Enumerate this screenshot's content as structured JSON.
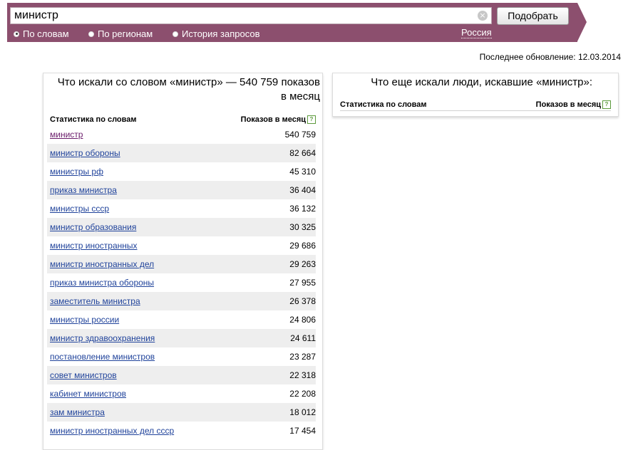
{
  "search": {
    "value": "министр",
    "submit_label": "Подобрать"
  },
  "modes": [
    {
      "label": "По словам",
      "checked": true
    },
    {
      "label": "По регионам",
      "checked": false
    },
    {
      "label": "История запросов",
      "checked": false
    }
  ],
  "region": "Россия",
  "last_update": "Последнее обновление:  12.03.2014",
  "left_panel": {
    "title": "Что искали со словом «министр» — 540 759 показов в месяц",
    "col_stats": "Статистика по словам",
    "col_shows": "Показов в месяц",
    "rows": [
      {
        "query": "министр",
        "count": "540 759"
      },
      {
        "query": "министр обороны",
        "count": "82 664"
      },
      {
        "query": "министры рф",
        "count": "45 310"
      },
      {
        "query": "приказ министра",
        "count": "36 404"
      },
      {
        "query": "министры ссср",
        "count": "36 132"
      },
      {
        "query": "министр образования",
        "count": "30 325"
      },
      {
        "query": "министр иностранных",
        "count": "29 686"
      },
      {
        "query": "министр иностранных дел",
        "count": "29 263"
      },
      {
        "query": "приказ министра обороны",
        "count": "27 955"
      },
      {
        "query": "заместитель министра",
        "count": "26 378"
      },
      {
        "query": "министры россии",
        "count": "24 806"
      },
      {
        "query": "министр здравоохранения",
        "count": "24 611"
      },
      {
        "query": "постановление министров",
        "count": "23 287"
      },
      {
        "query": "совет министров",
        "count": "22 318"
      },
      {
        "query": "кабинет министров",
        "count": "22 208"
      },
      {
        "query": "зам министра",
        "count": "18 012"
      },
      {
        "query": "министр иностранных дел ссср",
        "count": "17 454"
      }
    ]
  },
  "right_panel": {
    "title": "Что еще искали люди, искавшие «министр»:",
    "col_stats": "Статистика по словам",
    "col_shows": "Показов в месяц"
  },
  "icons": {
    "clear": "clear-icon",
    "help": "help-icon"
  },
  "colors": {
    "bar": "#8c4f6e",
    "link": "#20439b",
    "visited_link": "#6a1b6a",
    "row_alt": "#eeeeee"
  }
}
